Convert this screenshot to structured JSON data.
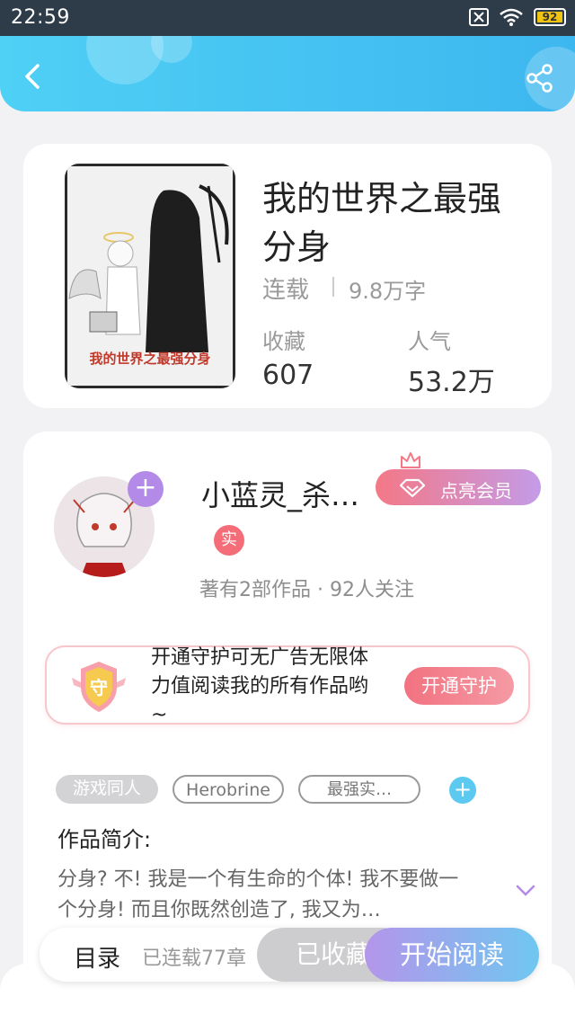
{
  "status_bar": {
    "time": "22:59",
    "battery": "92"
  },
  "book": {
    "title": "我的世界之最强分身",
    "status": "连载",
    "word_count": "9.8万字",
    "stats": [
      {
        "label": "收藏",
        "value": "607"
      },
      {
        "label": "人气",
        "value": "53.2万"
      }
    ]
  },
  "author": {
    "name": "小蓝灵_杀…",
    "real_badge": "实",
    "works_info": "著有2部作品 · 92人关注",
    "vip_button": "点亮会员"
  },
  "guard": {
    "badge_char": "守",
    "text": "开通守护可无广告无限体力值阅读我的所有作品哟~",
    "button": "开通守护"
  },
  "tags": [
    "游戏同人",
    "Herobrine",
    "最强实…"
  ],
  "intro": {
    "title": "作品简介:",
    "text": "分身? 不! 我是一个有生命的个体! 我不要做一个分身! 而且你既然创造了, 我又为…"
  },
  "bottom": {
    "toc": "目录",
    "serial_count": "已连载77章",
    "collected": "已收藏",
    "start_reading": "开始阅读"
  },
  "colors": {
    "header": "#3db7ef",
    "accent_pink": "#f47886",
    "accent_purple": "#b38ae8"
  }
}
